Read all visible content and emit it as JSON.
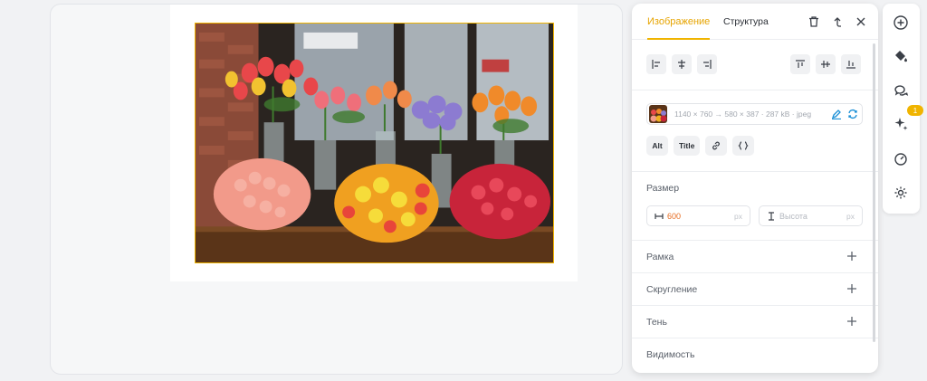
{
  "panel": {
    "tabs": [
      {
        "label": "Изображение"
      },
      {
        "label": "Структура"
      }
    ],
    "file": {
      "meta": "1140 × 760 → 580 × 387 · 287 kB · jpeg"
    },
    "chips": {
      "alt": "Alt",
      "title": "Title"
    },
    "size": {
      "title": "Размер",
      "width_value": "600",
      "width_unit": "px",
      "height_placeholder": "Высота",
      "height_unit": "px"
    },
    "sections": [
      {
        "label": "Рамка"
      },
      {
        "label": "Скругление"
      },
      {
        "label": "Тень"
      },
      {
        "label": "Видимость"
      }
    ]
  },
  "rail": {
    "badge": "1"
  },
  "colors": {
    "accent": "#f0b400",
    "width_value": "#e66a1e"
  }
}
